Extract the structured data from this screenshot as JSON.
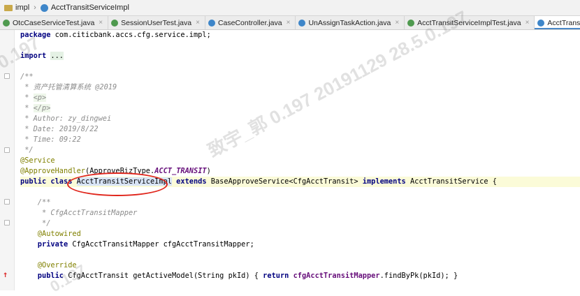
{
  "breadcrumb": {
    "folder": "impl",
    "file": "AcctTransitServiceImpl"
  },
  "tabs": [
    {
      "label": "OtcCaseServiceTest.java",
      "icon": "test-class-icon"
    },
    {
      "label": "SessionUserTest.java",
      "icon": "test-class-icon"
    },
    {
      "label": "CaseController.java",
      "icon": "class-icon"
    },
    {
      "label": "UnAssignTaskAction.java",
      "icon": "class-icon"
    },
    {
      "label": "AcctTransitServiceImplTest.java",
      "icon": "test-class-icon"
    },
    {
      "label": "AcctTransitServiceImpl.java",
      "icon": "class-icon",
      "active": true
    }
  ],
  "tab_close": "×",
  "code": {
    "package_kw": "package",
    "package_name": " com.citicbank.accs.cfg.service.impl;",
    "import_kw": "import",
    "import_fold": "...",
    "doc_open": "/**",
    "doc_title": " * 资产托管清算系统 @2019",
    "doc_p_prefix": " * ",
    "doc_p": "<p>",
    "doc_p_close": "</p>",
    "doc_author": " * Author: zy_dingwei",
    "doc_date": " * Date: 2019/8/22",
    "doc_time": " * Time: 09:22",
    "doc_close": " */",
    "ann_service": "@Service",
    "ann_approve": "@ApproveHandler",
    "approve_args": "(ApproveBizType.",
    "approve_const": "ACCT_TRANSIT",
    "approve_end": ")",
    "public_class": "public class ",
    "class_name": "AcctTransitServiceImpl",
    "extends_kw": " extends ",
    "base_class": "BaseApproveService<CfgAcctTransit> ",
    "implements_kw": "implements",
    "iface": " AcctTransitService {",
    "inner_doc_open": "    /**",
    "inner_doc_body": "     * CfgAcctTransitMapper",
    "inner_doc_close": "     */",
    "autowired": "    @Autowired",
    "private_kw": "    private",
    "field_decl": " CfgAcctTransitMapper cfgAcctTransitMapper;",
    "override": "    @Override",
    "public_kw": "    public",
    "method_sig": " CfgAcctTransit getActiveModel(String pkId) { ",
    "return_kw": "return",
    "field_ref": " cfgAcctTransitMapper",
    "method_end": ".findByPk(pkId); }"
  },
  "watermarks": [
    "0.197",
    "致宇_郭 0.197 20191129 28.5.0.197",
    "0.197"
  ]
}
